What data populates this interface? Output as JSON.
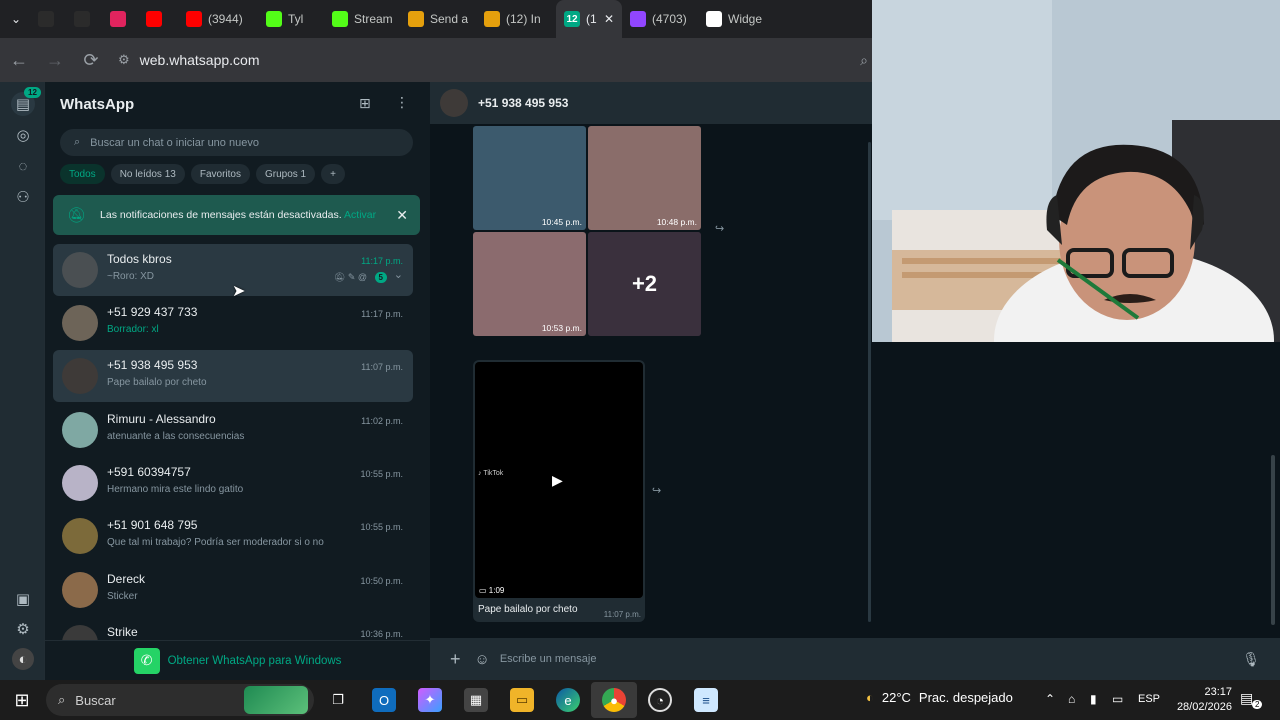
{
  "browser": {
    "tabs": [
      {
        "label": "",
        "icon": "dark-circle-icon",
        "color": "#2b2b2b"
      },
      {
        "label": "",
        "icon": "dark-circle-icon",
        "color": "#2b2b2b"
      },
      {
        "label": "",
        "icon": "pink-app-icon",
        "color": "#e0245e"
      },
      {
        "label": "",
        "icon": "youtube-icon",
        "color": "#ff0000"
      },
      {
        "label": "(3944)",
        "icon": "youtube-icon",
        "color": "#ff0000"
      },
      {
        "label": "Tyl",
        "icon": "kick-icon",
        "color": "#53fc18"
      },
      {
        "label": "Stream",
        "icon": "kick-icon",
        "color": "#53fc18"
      },
      {
        "label": "Send a",
        "icon": "streamelements-icon",
        "color": "#e5a00d"
      },
      {
        "label": "(12) In",
        "icon": "streamelements-icon",
        "color": "#e5a00d"
      },
      {
        "label": "(1",
        "icon": "whatsapp-icon",
        "color": "#00a884"
      },
      {
        "label": "(4703)",
        "icon": "twitch-icon",
        "color": "#9146ff"
      },
      {
        "label": "Widge",
        "icon": "widget-icon",
        "color": "#ffffff"
      }
    ],
    "active_tab_badge": "12",
    "url": "web.whatsapp.com"
  },
  "rail": {
    "badge": "12"
  },
  "sidebar": {
    "title": "WhatsApp",
    "search_placeholder": "Buscar un chat o iniciar uno nuevo",
    "filters": [
      "Todos",
      "No leídos 13",
      "Favoritos",
      "Grupos 1",
      "+"
    ],
    "notice": {
      "text": "Las notificaciones de mensajes están desactivadas.",
      "action": "Activar"
    },
    "chats": [
      {
        "name": "Todos kbros",
        "preview": "~Roro: XD",
        "time": "11:17 p.m.",
        "unread": "5",
        "avatar_color": "#4a4f52"
      },
      {
        "name": "+51 929 437 733",
        "preview": "Borrador: xl",
        "time": "11:17 p.m.",
        "avatar_color": "#6d6458"
      },
      {
        "name": "+51 938 495 953",
        "preview": "Pape bailalo por cheto",
        "time": "11:07 p.m.",
        "avatar_color": "#3e3a38"
      },
      {
        "name": "Rimuru - Alessandro",
        "preview": "atenuante a las consecuencias",
        "time": "11:02 p.m.",
        "avatar_color": "#7fa8a3"
      },
      {
        "name": "+591 60394757",
        "preview": "Hermano mira este lindo gatito",
        "time": "10:55 p.m.",
        "avatar_color": "#b8b3c7"
      },
      {
        "name": "+51 901 648 795",
        "preview": "Que tal mi trabajo? Podría ser moderador si o no",
        "time": "10:55 p.m.",
        "avatar_color": "#7c6a3a"
      },
      {
        "name": "Dereck",
        "preview": "Sticker",
        "time": "10:50 p.m.",
        "avatar_color": "#8b6a4a"
      },
      {
        "name": "Strike",
        "preview": "",
        "time": "10:36 p.m.",
        "avatar_color": "#3a3a3a"
      }
    ],
    "get_windows": "Obtener WhatsApp para Windows"
  },
  "conversation": {
    "contact": "+51 938 495 953",
    "media": [
      {
        "time": "10:45 p.m.",
        "color": "#3c5a6d"
      },
      {
        "time": "10:48 p.m.",
        "color": "#8a6d6a"
      },
      {
        "time": "10:53 p.m.",
        "color": "#8b6b6e"
      },
      {
        "time": "",
        "color": "#5a4a5e",
        "more": "+2"
      }
    ],
    "video": {
      "duration": "1:09",
      "caption": "Pape bailalo por cheto",
      "time": "11:07 p.m."
    },
    "composer_placeholder": "Escribe un mensaje"
  },
  "taskbar": {
    "search": "Buscar",
    "weather_temp": "22°C",
    "weather_desc": "Prac. despejado",
    "lang": "ESP",
    "time": "23:17",
    "date": "28/02/2026",
    "notif_count": "2"
  }
}
